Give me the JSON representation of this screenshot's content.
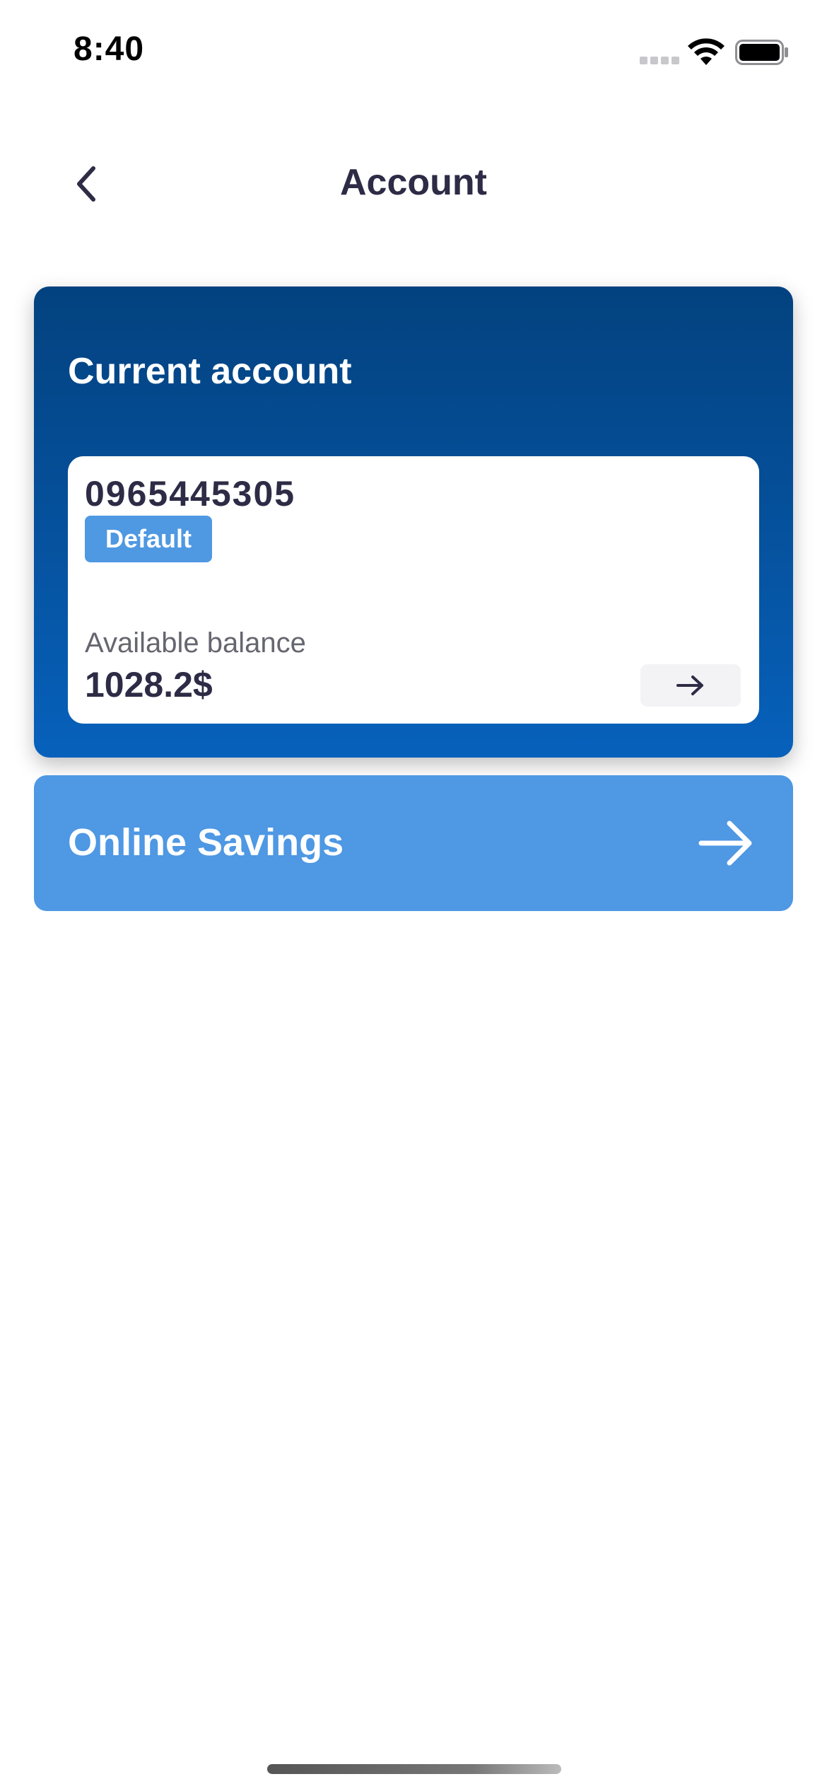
{
  "status_bar": {
    "time": "8:40",
    "icons": [
      "cellular-signal-icon",
      "wifi-icon",
      "battery-icon"
    ]
  },
  "nav": {
    "back_icon": "chevron-left-icon",
    "title": "Account"
  },
  "current_account": {
    "title": "Current account",
    "account_number": "0965445305",
    "badge": "Default",
    "balance_label": "Available balance",
    "balance_value": "1028.2$",
    "details_icon": "arrow-right-icon"
  },
  "savings": {
    "label": "Online Savings",
    "icon": "arrow-right-icon"
  },
  "colors": {
    "title_text": "#2d2b45",
    "card_gradient_top": "#03427f",
    "card_gradient_bottom": "#0761bb",
    "badge": "#4f98e2",
    "savings_card": "#4e98e4",
    "muted_text": "#666670"
  }
}
